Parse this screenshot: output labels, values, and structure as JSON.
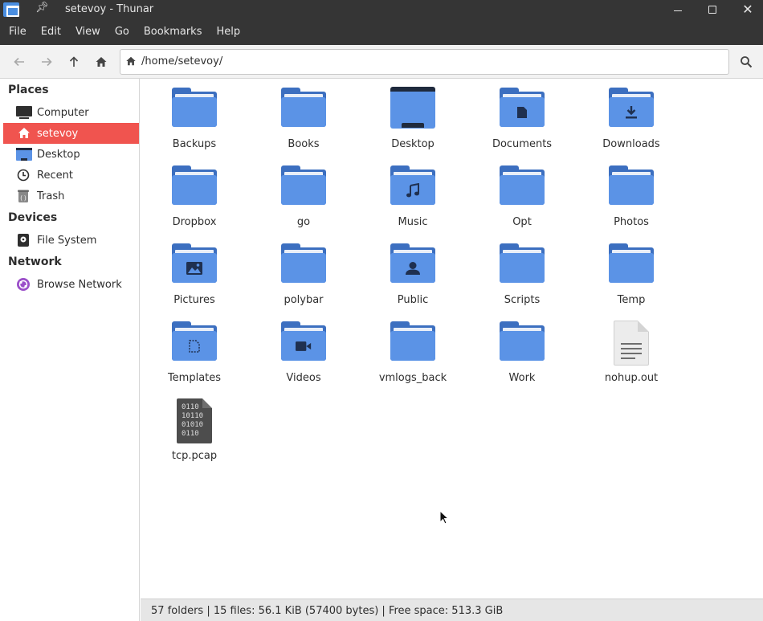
{
  "window": {
    "title": "setevoy - Thunar"
  },
  "menubar": {
    "items": [
      "File",
      "Edit",
      "View",
      "Go",
      "Bookmarks",
      "Help"
    ]
  },
  "toolbar": {
    "location": "/home/setevoy/"
  },
  "sidebar": {
    "sections": [
      {
        "header": "Places",
        "items": [
          {
            "label": "Computer",
            "icon": "computer-icon"
          },
          {
            "label": "setevoy",
            "icon": "home-icon",
            "active": true
          },
          {
            "label": "Desktop",
            "icon": "desktop-icon"
          },
          {
            "label": "Recent",
            "icon": "clock-icon"
          },
          {
            "label": "Trash",
            "icon": "trash-icon"
          }
        ]
      },
      {
        "header": "Devices",
        "items": [
          {
            "label": "File System",
            "icon": "drive-icon"
          }
        ]
      },
      {
        "header": "Network",
        "items": [
          {
            "label": "Browse Network",
            "icon": "network-icon"
          }
        ]
      }
    ]
  },
  "files": [
    {
      "name": "Backups",
      "type": "folder"
    },
    {
      "name": "Books",
      "type": "folder"
    },
    {
      "name": "Desktop",
      "type": "desktop"
    },
    {
      "name": "Documents",
      "type": "folder",
      "emblem": "document"
    },
    {
      "name": "Downloads",
      "type": "folder",
      "emblem": "download"
    },
    {
      "name": "Dropbox",
      "type": "folder"
    },
    {
      "name": "go",
      "type": "folder"
    },
    {
      "name": "Music",
      "type": "folder",
      "emblem": "music"
    },
    {
      "name": "Opt",
      "type": "folder"
    },
    {
      "name": "Photos",
      "type": "folder"
    },
    {
      "name": "Pictures",
      "type": "folder",
      "emblem": "picture"
    },
    {
      "name": "polybar",
      "type": "folder"
    },
    {
      "name": "Public",
      "type": "folder",
      "emblem": "person"
    },
    {
      "name": "Scripts",
      "type": "folder"
    },
    {
      "name": "Temp",
      "type": "folder"
    },
    {
      "name": "Templates",
      "type": "folder",
      "emblem": "template"
    },
    {
      "name": "Videos",
      "type": "folder",
      "emblem": "video"
    },
    {
      "name": "vmlogs_back",
      "type": "folder"
    },
    {
      "name": "Work",
      "type": "folder"
    },
    {
      "name": "nohup.out",
      "type": "text"
    },
    {
      "name": "tcp.pcap",
      "type": "binary"
    }
  ],
  "statusbar": {
    "text": "57 folders  |  15 files: 56.1 KiB (57400 bytes)  |  Free space: 513.3 GiB"
  },
  "colors": {
    "titlebar": "#353535",
    "accent": "#f0544f",
    "folder_front": "#5b93e6",
    "folder_back": "#3c6fc0"
  }
}
